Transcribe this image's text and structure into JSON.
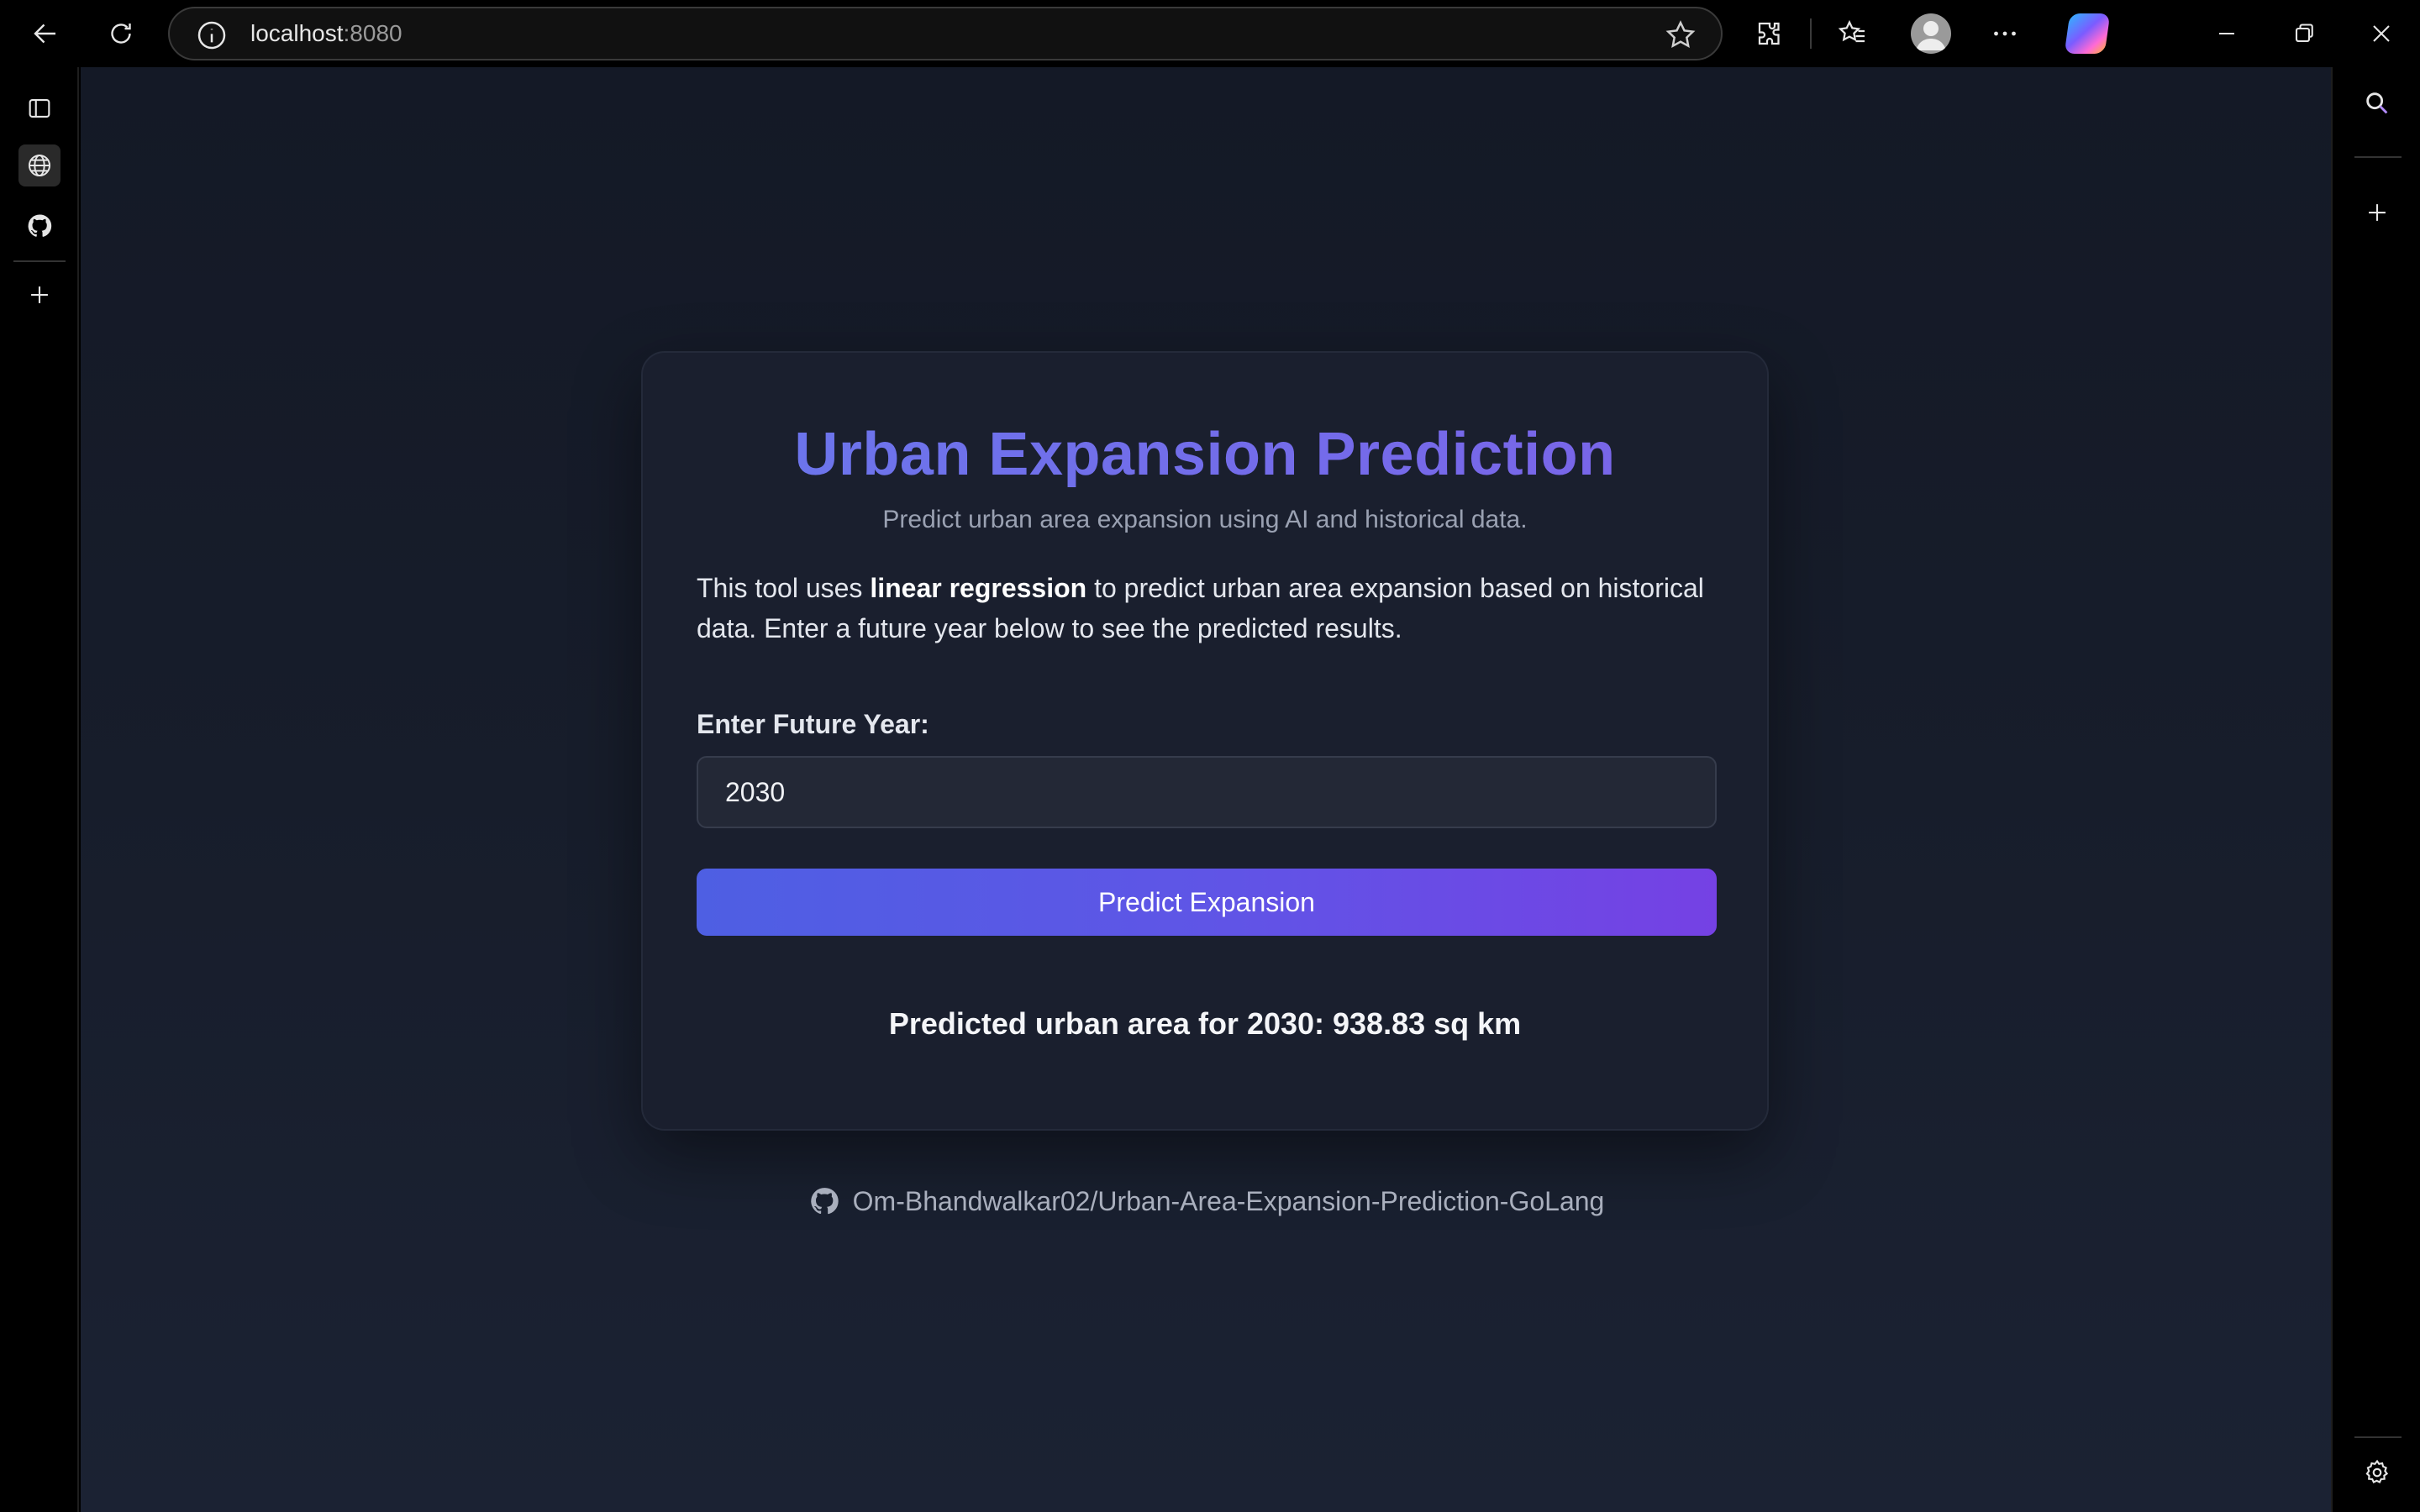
{
  "browser": {
    "url_host": "localhost",
    "url_port": ":8080"
  },
  "page": {
    "title": "Urban Expansion Prediction",
    "subtitle": "Predict urban area expansion using AI and historical data.",
    "description_prefix": "This tool uses ",
    "description_bold": "linear regression",
    "description_suffix": " to predict urban area expansion based on historical data. Enter a future year below to see the predicted results.",
    "input_label": "Enter Future Year:",
    "year_value": "2030",
    "button_label": "Predict Expansion",
    "result_text": "Predicted urban area for 2030: 938.83 sq km",
    "footer_link": "Om-Bhandwalkar02/Urban-Area-Expansion-Prediction-GoLang"
  },
  "colors": {
    "accent": "#6a77ec",
    "button_start": "#4e5fe3",
    "button_end": "#7541e4",
    "background": "#171d2b"
  }
}
